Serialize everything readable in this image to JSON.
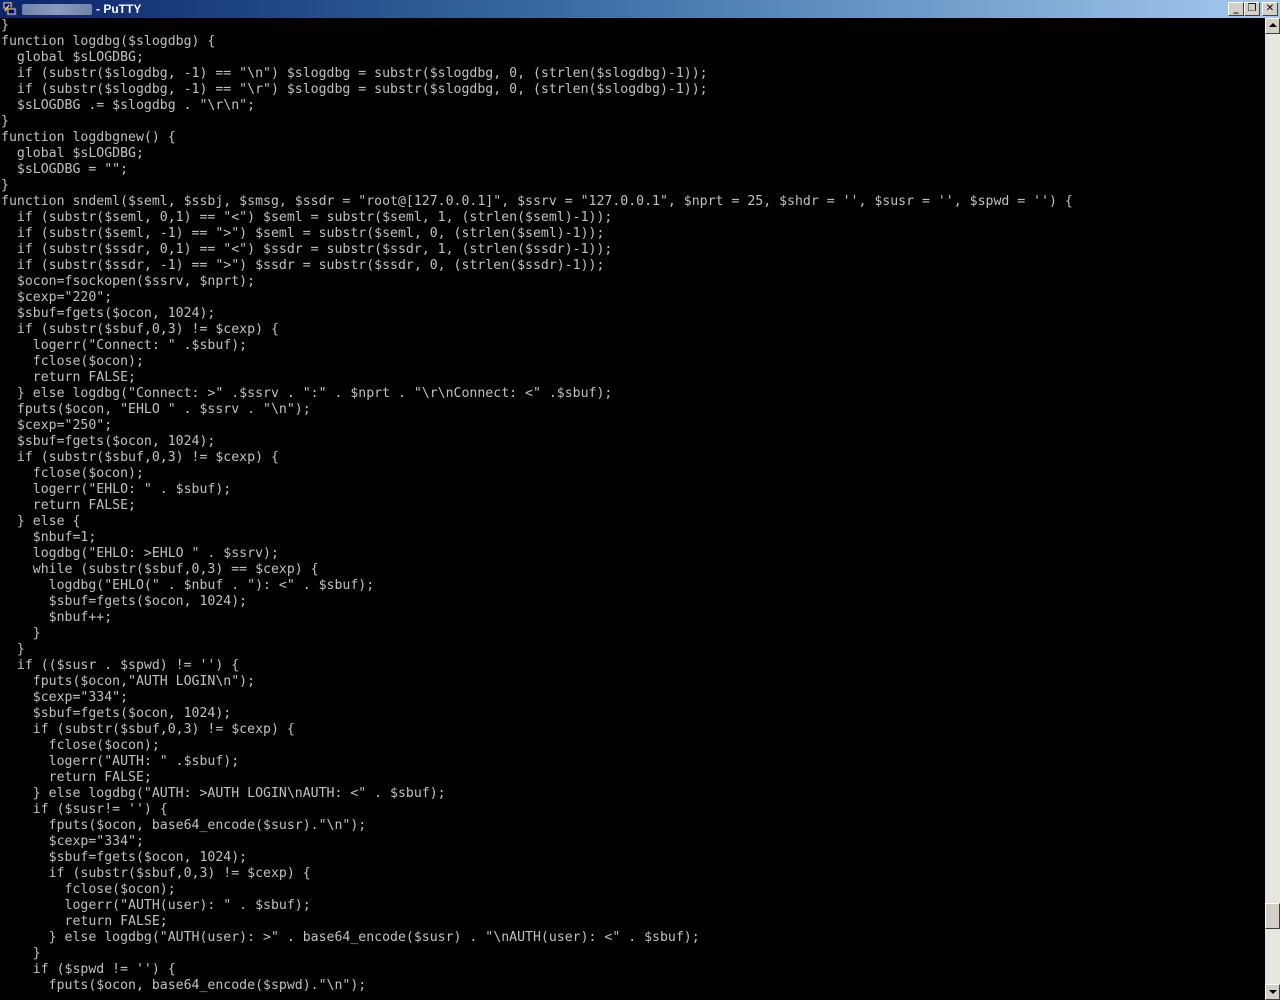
{
  "window": {
    "title": "- PuTTY",
    "app_icon": "putty-icon",
    "controls": {
      "minimize": "_",
      "maximize": "❐",
      "close": "✕"
    }
  },
  "terminal": {
    "lines": [
      "}",
      "function logdbg($slogdbg) {",
      "  global $sLOGDBG;",
      "  if (substr($slogdbg, -1) == \"\\n\") $slogdbg = substr($slogdbg, 0, (strlen($slogdbg)-1));",
      "  if (substr($slogdbg, -1) == \"\\r\") $slogdbg = substr($slogdbg, 0, (strlen($slogdbg)-1));",
      "  $sLOGDBG .= $slogdbg . \"\\r\\n\";",
      "}",
      "function logdbgnew() {",
      "  global $sLOGDBG;",
      "  $sLOGDBG = \"\";",
      "}",
      "function sndeml($seml, $ssbj, $smsg, $ssdr = \"root@[127.0.0.1]\", $ssrv = \"127.0.0.1\", $nprt = 25, $shdr = '', $susr = '', $spwd = '') {",
      "  if (substr($seml, 0,1) == \"<\") $seml = substr($seml, 1, (strlen($seml)-1));",
      "  if (substr($seml, -1) == \">\") $seml = substr($seml, 0, (strlen($seml)-1));",
      "  if (substr($ssdr, 0,1) == \"<\") $ssdr = substr($ssdr, 1, (strlen($ssdr)-1));",
      "  if (substr($ssdr, -1) == \">\") $ssdr = substr($ssdr, 0, (strlen($ssdr)-1));",
      "  $ocon=fsockopen($ssrv, $nprt);",
      "  $cexp=\"220\";",
      "  $sbuf=fgets($ocon, 1024);",
      "  if (substr($sbuf,0,3) != $cexp) {",
      "    logerr(\"Connect: \" .$sbuf);",
      "    fclose($ocon);",
      "    return FALSE;",
      "  } else logdbg(\"Connect: >\" .$ssrv . \":\" . $nprt . \"\\r\\nConnect: <\" .$sbuf);",
      "  fputs($ocon, \"EHLO \" . $ssrv . \"\\n\");",
      "  $cexp=\"250\";",
      "  $sbuf=fgets($ocon, 1024);",
      "  if (substr($sbuf,0,3) != $cexp) {",
      "    fclose($ocon);",
      "    logerr(\"EHLO: \" . $sbuf);",
      "    return FALSE;",
      "  } else {",
      "    $nbuf=1;",
      "    logdbg(\"EHLO: >EHLO \" . $ssrv);",
      "    while (substr($sbuf,0,3) == $cexp) {",
      "      logdbg(\"EHLO(\" . $nbuf . \"): <\" . $sbuf);",
      "      $sbuf=fgets($ocon, 1024);",
      "      $nbuf++;",
      "    }",
      "  }",
      "  if (($susr . $spwd) != '') {",
      "    fputs($ocon,\"AUTH LOGIN\\n\");",
      "    $cexp=\"334\";",
      "    $sbuf=fgets($ocon, 1024);",
      "    if (substr($sbuf,0,3) != $cexp) {",
      "      fclose($ocon);",
      "      logerr(\"AUTH: \" .$sbuf);",
      "      return FALSE;",
      "    } else logdbg(\"AUTH: >AUTH LOGIN\\nAUTH: <\" . $sbuf);",
      "    if ($susr!= '') {",
      "      fputs($ocon, base64_encode($susr).\"\\n\");",
      "      $cexp=\"334\";",
      "      $sbuf=fgets($ocon, 1024);",
      "      if (substr($sbuf,0,3) != $cexp) {",
      "        fclose($ocon);",
      "        logerr(\"AUTH(user): \" . $sbuf);",
      "        return FALSE;",
      "      } else logdbg(\"AUTH(user): >\" . base64_encode($susr) . \"\\nAUTH(user): <\" . $sbuf);",
      "    }",
      "    if ($spwd != '') {",
      "      fputs($ocon, base64_encode($spwd).\"\\n\");"
    ]
  },
  "scrollbar": {
    "position_fraction": 0.94
  },
  "colors": {
    "terminal_bg": "#000000",
    "terminal_fg": "#c0c0c0",
    "titlebar_start": "#0a246a",
    "titlebar_end": "#a6caf0"
  }
}
